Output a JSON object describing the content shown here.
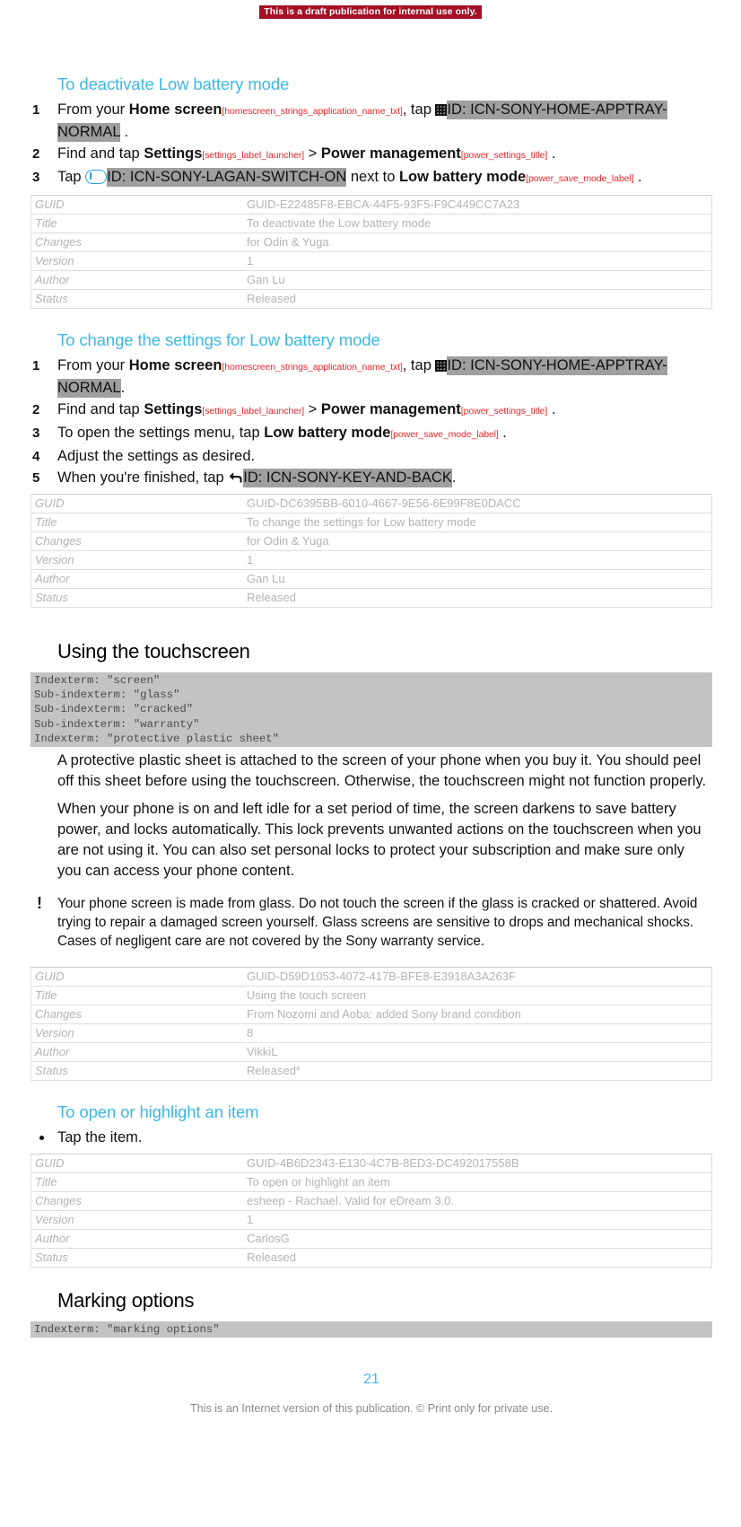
{
  "draft_banner": "This is a draft publication for internal use only.",
  "sections": [
    {
      "id": "deactivate-low-battery-mode",
      "heading": "To deactivate Low battery mode",
      "steps": [
        {
          "num": "1",
          "parts": [
            {
              "t": "text",
              "v": "From your "
            },
            {
              "t": "bold",
              "v": "Home screen"
            },
            {
              "t": "strid",
              "v": "[homescreen_strings_application_name_txt]"
            },
            {
              "t": "text",
              "v": ", tap "
            },
            {
              "t": "icon",
              "v": "apptray-grid-icon"
            },
            {
              "t": "iconref",
              "v": "ID: ICN-SONY-HOME-APPTRAY-NORMAL"
            },
            {
              "t": "text",
              "v": " ."
            }
          ]
        },
        {
          "num": "2",
          "parts": [
            {
              "t": "text",
              "v": "Find and tap "
            },
            {
              "t": "bold",
              "v": "Settings"
            },
            {
              "t": "strid",
              "v": "[settings_label_launcher]"
            },
            {
              "t": "text",
              "v": " > "
            },
            {
              "t": "bold",
              "v": "Power management"
            },
            {
              "t": "strid",
              "v": "[power_settings_title]"
            },
            {
              "t": "text",
              "v": " ."
            }
          ]
        },
        {
          "num": "3",
          "parts": [
            {
              "t": "text",
              "v": "Tap "
            },
            {
              "t": "icon",
              "v": "switch-on-icon"
            },
            {
              "t": "iconref",
              "v": "ID: ICN-SONY-LAGAN-SWITCH-ON"
            },
            {
              "t": "text",
              "v": " next to "
            },
            {
              "t": "bold",
              "v": "Low battery mode"
            },
            {
              "t": "strid",
              "v": "[power_save_mode_label]"
            },
            {
              "t": "text",
              "v": " ."
            }
          ]
        }
      ],
      "meta": {
        "rows": [
          {
            "key": "GUID",
            "value": "GUID-E22485F8-EBCA-44F5-93F5-F9C449CC7A23"
          },
          {
            "key": "Title",
            "value": "To deactivate the Low battery mode"
          },
          {
            "key": "Changes",
            "value": "for Odin & Yuga"
          },
          {
            "key": "Version",
            "value": "1"
          },
          {
            "key": "Author",
            "value": "Gan Lu"
          },
          {
            "key": "Status",
            "value": "Released"
          }
        ]
      }
    },
    {
      "id": "change-settings-low-battery-mode",
      "heading": "To change the settings for Low battery mode",
      "steps": [
        {
          "num": "1",
          "parts": [
            {
              "t": "text",
              "v": "From your "
            },
            {
              "t": "bold",
              "v": "Home screen"
            },
            {
              "t": "strid",
              "v": "[homescreen_strings_application_name_txt]"
            },
            {
              "t": "text",
              "v": ", tap "
            },
            {
              "t": "icon",
              "v": "apptray-grid-icon"
            },
            {
              "t": "iconref",
              "v": "ID: ICN-SONY-HOME-APPTRAY-NORMAL"
            },
            {
              "t": "text",
              "v": "."
            }
          ]
        },
        {
          "num": "2",
          "parts": [
            {
              "t": "text",
              "v": "Find and tap "
            },
            {
              "t": "bold",
              "v": "Settings"
            },
            {
              "t": "strid",
              "v": "[settings_label_launcher]"
            },
            {
              "t": "text",
              "v": " > "
            },
            {
              "t": "bold",
              "v": "Power management"
            },
            {
              "t": "strid",
              "v": "[power_settings_title]"
            },
            {
              "t": "text",
              "v": " ."
            }
          ]
        },
        {
          "num": "3",
          "parts": [
            {
              "t": "text",
              "v": "To open the settings menu, tap "
            },
            {
              "t": "bold",
              "v": "Low battery mode"
            },
            {
              "t": "strid",
              "v": "[power_save_mode_label]"
            },
            {
              "t": "text",
              "v": " ."
            }
          ]
        },
        {
          "num": "4",
          "parts": [
            {
              "t": "text",
              "v": "Adjust the settings as desired."
            }
          ]
        },
        {
          "num": "5",
          "parts": [
            {
              "t": "text",
              "v": "When you're finished, tap "
            },
            {
              "t": "icon",
              "v": "back-arrow-icon"
            },
            {
              "t": "iconref",
              "v": "ID: ICN-SONY-KEY-AND-BACK"
            },
            {
              "t": "text",
              "v": "."
            }
          ]
        }
      ],
      "meta": {
        "rows": [
          {
            "key": "GUID",
            "value": "GUID-DC6395BB-6010-4667-9E56-6E99F8E0DACC"
          },
          {
            "key": "Title",
            "value": "To change the settings for Low battery mode"
          },
          {
            "key": "Changes",
            "value": "for Odin & Yuga"
          },
          {
            "key": "Version",
            "value": "1"
          },
          {
            "key": "Author",
            "value": "Gan Lu"
          },
          {
            "key": "Status",
            "value": "Released"
          }
        ]
      }
    }
  ],
  "touchscreen": {
    "heading": "Using the touchscreen",
    "indexterms": "Indexterm: \"screen\"\nSub-indexterm: \"glass\"\nSub-indexterm: \"cracked\"\nSub-indexterm: \"warranty\"\nIndexterm: \"protective plastic sheet\"",
    "paragraph_1": "A protective plastic sheet is attached to the screen of your phone when you buy it. You should peel off this sheet before using the touchscreen. Otherwise, the touchscreen might not function properly.",
    "paragraph_2": "When your phone is on and left idle for a set period of time, the screen darkens to save battery power, and locks automatically. This lock prevents unwanted actions on the touchscreen when you are not using it. You can also set personal locks to protect your subscription and make sure only you can access your phone content.",
    "note_icon": "exclamation-icon",
    "note": "Your phone screen is made from glass. Do not touch the screen if the glass is cracked or shattered. Avoid trying to repair a damaged screen yourself. Glass screens are sensitive to drops and mechanical shocks. Cases of negligent care are not covered by the Sony warranty service.",
    "meta": {
      "rows": [
        {
          "key": "GUID",
          "value": "GUID-D59D1053-4072-417B-BFE8-E3918A3A263F"
        },
        {
          "key": "Title",
          "value": "Using the touch screen"
        },
        {
          "key": "Changes",
          "value": "From Nozomi and Aoba: added Sony brand condition"
        },
        {
          "key": "Version",
          "value": "8"
        },
        {
          "key": "Author",
          "value": "VikkiL"
        },
        {
          "key": "Status",
          "value": "Released*"
        }
      ]
    }
  },
  "open_highlight": {
    "heading": "To open or highlight an item",
    "bullet": "Tap the item.",
    "meta": {
      "rows": [
        {
          "key": "GUID",
          "value": "GUID-4B6D2343-E130-4C7B-8ED3-DC492017558B"
        },
        {
          "key": "Title",
          "value": "To open or highlight an item"
        },
        {
          "key": "Changes",
          "value": "esheep - Rachael. Valid for eDream 3.0."
        },
        {
          "key": "Version",
          "value": "1"
        },
        {
          "key": "Author",
          "value": "CarlosG"
        },
        {
          "key": "Status",
          "value": "Released"
        }
      ]
    }
  },
  "marking_options": {
    "heading": "Marking options",
    "indexterms": "Indexterm: \"marking options\""
  },
  "footer": {
    "page_number": "21",
    "note": "This is an Internet version of this publication. © Print only for private use."
  },
  "colors": {
    "accent": "#3db8e3",
    "draft_banner_bg": "#a51025",
    "string_id": "#e8262b",
    "icon_ref_bg": "#9f9f9f",
    "indexterm_bg": "#c3c3c3",
    "meta_text": "#b4b4b4"
  }
}
